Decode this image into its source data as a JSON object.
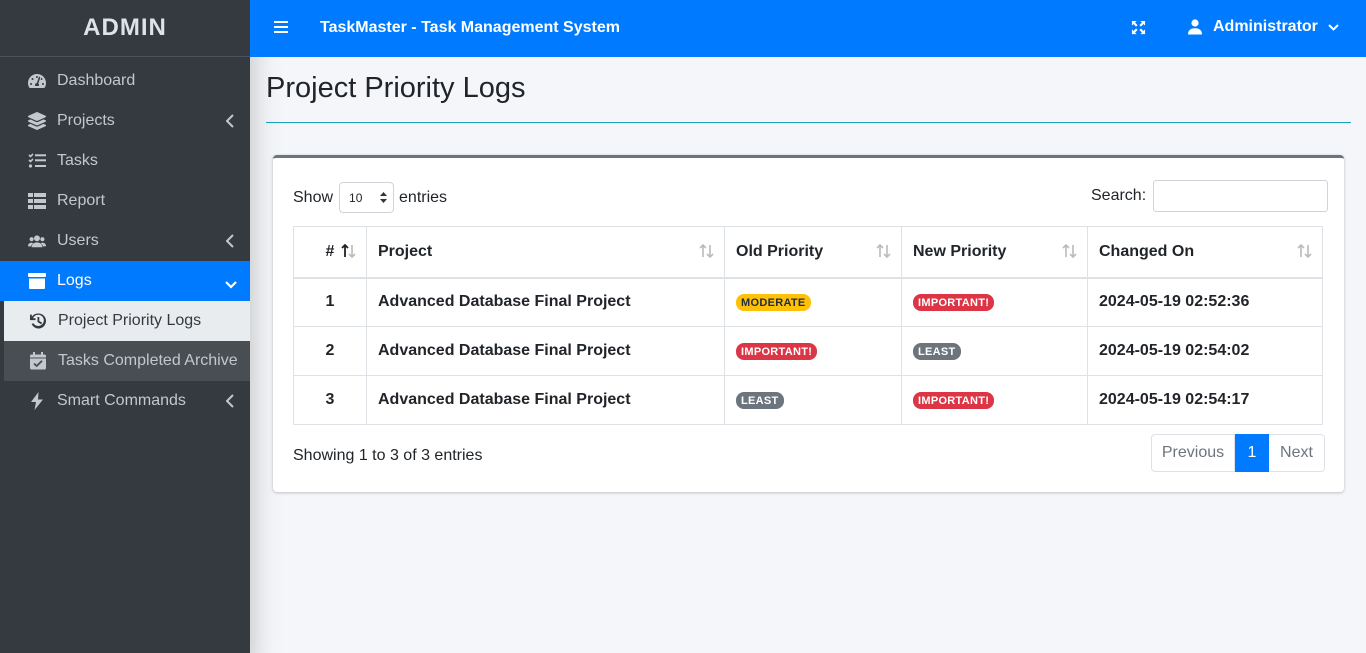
{
  "brand": "ADMIN",
  "header": {
    "title": "TaskMaster - Task Management System",
    "user": "Administrator"
  },
  "sidebar": {
    "items": [
      {
        "label": "Dashboard",
        "icon": "tachometer-icon"
      },
      {
        "label": "Projects",
        "icon": "layers-icon"
      },
      {
        "label": "Tasks",
        "icon": "tasks-icon"
      },
      {
        "label": "Report",
        "icon": "table-icon"
      },
      {
        "label": "Users",
        "icon": "users-icon"
      },
      {
        "label": "Logs",
        "icon": "archive-icon"
      },
      {
        "label": "Smart Commands",
        "icon": "bolt-icon"
      }
    ],
    "logs_sub": [
      {
        "label": "Project Priority Logs",
        "icon": "history-icon"
      },
      {
        "label": "Tasks Completed Archive",
        "icon": "calendar-check-icon"
      }
    ]
  },
  "page": {
    "title": "Project Priority Logs"
  },
  "controls": {
    "show_label": "Show",
    "entries_label": "entries",
    "page_length": "10",
    "search_label": "Search:",
    "search_value": ""
  },
  "table": {
    "headers": [
      "#",
      "Project",
      "Old Priority",
      "New Priority",
      "Changed On"
    ],
    "rows": [
      {
        "num": "1",
        "project": "Advanced Database Final Project",
        "old": "MODERATE",
        "new": "IMPORTANT!",
        "changed": "2024-05-19 02:52:36"
      },
      {
        "num": "2",
        "project": "Advanced Database Final Project",
        "old": "IMPORTANT!",
        "new": "LEAST",
        "changed": "2024-05-19 02:54:02"
      },
      {
        "num": "3",
        "project": "Advanced Database Final Project",
        "old": "LEAST",
        "new": "IMPORTANT!",
        "changed": "2024-05-19 02:54:17"
      }
    ]
  },
  "badge_colors": {
    "MODERATE": {
      "bg": "#ffc107",
      "fg": "#1f2d3d"
    },
    "IMPORTANT!": {
      "bg": "#dc3545",
      "fg": "#ffffff"
    },
    "LEAST": {
      "bg": "#6c757d",
      "fg": "#ffffff"
    }
  },
  "footer": {
    "info": "Showing 1 to 3 of 3 entries",
    "previous": "Previous",
    "current_page": "1",
    "next": "Next"
  }
}
